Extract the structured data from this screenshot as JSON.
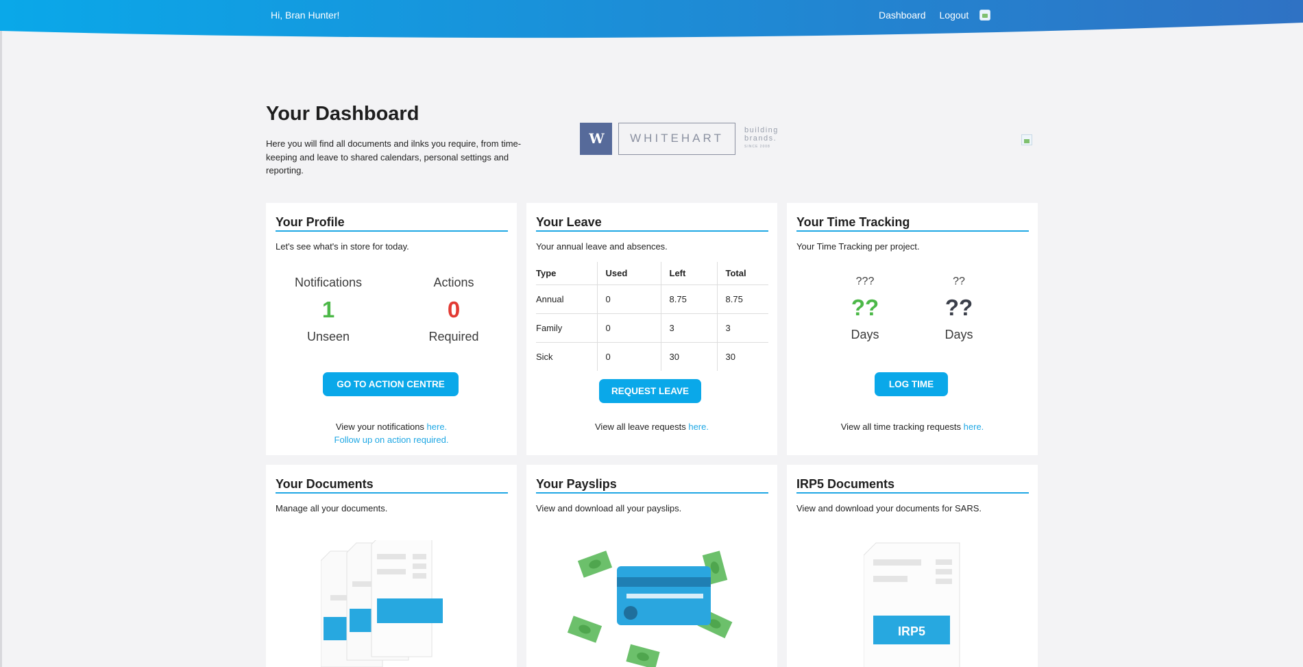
{
  "header": {
    "greeting": "Hi, Bran Hunter!",
    "nav": [
      "Dashboard",
      "Logout"
    ]
  },
  "intro": {
    "title": "Your Dashboard",
    "description": "Here you will find all documents and ilnks you require, from time-keeping and leave to shared calendars, personal settings and reporting."
  },
  "logo": {
    "mark": "W",
    "word": "WHITEHART",
    "tag_line1": "building",
    "tag_line2": "brands.",
    "tag_small": "SINCE 2008"
  },
  "profile": {
    "title": "Your Profile",
    "subtitle": "Let's see what's in store for today.",
    "notifications_label": "Notifications",
    "notifications_value": "1",
    "notifications_foot": "Unseen",
    "actions_label": "Actions",
    "actions_value": "0",
    "actions_foot": "Required",
    "button": "GO TO ACTION CENTRE",
    "link_line1_text": "View your notifications ",
    "link_line1_link": "here.",
    "link_line2": "Follow up on action required."
  },
  "leave": {
    "title": "Your Leave",
    "subtitle": "Your annual leave and absences.",
    "columns": [
      "Type",
      "Used",
      "Left",
      "Total"
    ],
    "rows": [
      [
        "Annual",
        "0",
        "8.75",
        "8.75"
      ],
      [
        "Family",
        "0",
        "3",
        "3"
      ],
      [
        "Sick",
        "0",
        "30",
        "30"
      ]
    ],
    "button": "REQUEST LEAVE",
    "link_text": "View all leave requests ",
    "link_link": "here."
  },
  "time": {
    "title": "Your Time Tracking",
    "subtitle": "Your Time Tracking per project.",
    "left_label": "???",
    "left_value": "??",
    "left_foot": "Days",
    "right_label": "??",
    "right_value": "??",
    "right_foot": "Days",
    "button": "LOG TIME",
    "link_text": "View all time tracking requests ",
    "link_link": "here."
  },
  "documents": {
    "title": "Your Documents",
    "subtitle": "Manage all your documents."
  },
  "payslips": {
    "title": "Your Payslips",
    "subtitle": "View and download all your payslips."
  },
  "irp5": {
    "title": "IRP5 Documents",
    "subtitle": "View and download your documents for SARS.",
    "doc_label": "IRP5"
  },
  "colors": {
    "accent": "#0aa8e9",
    "header_start": "#0aa8e9",
    "header_end": "#2f72c4",
    "positive": "#4cb848",
    "negative": "#e23a33"
  }
}
